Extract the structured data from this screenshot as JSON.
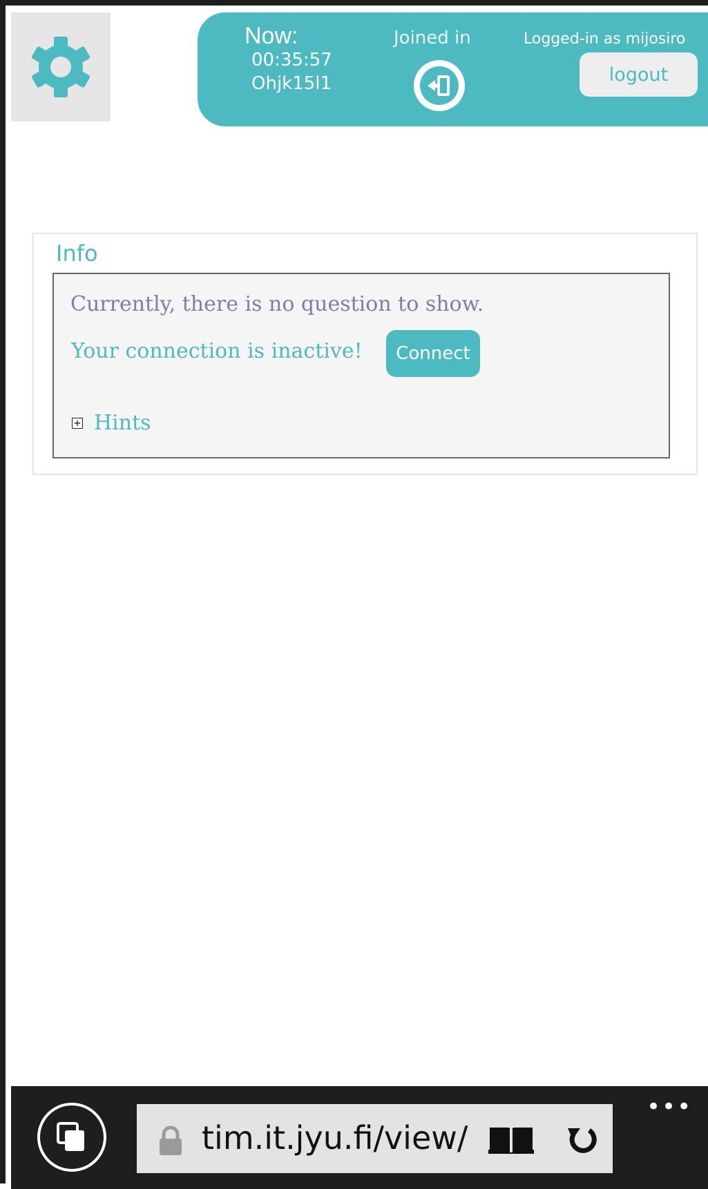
{
  "header": {
    "now_label": "Now:",
    "current_time": "00:35:57",
    "session_code": "Ohjk15l1",
    "joined_label": "Joined in",
    "logged_in_label": "Logged-in as mijosiro",
    "logout_label": "logout"
  },
  "info": {
    "title": "Info",
    "no_question_text": "Currently, there is no question to show.",
    "inactive_text": "Your connection is inactive!",
    "connect_label": "Connect",
    "hints_label": "Hints"
  },
  "browser": {
    "url": "tim.it.jyu.fi/view/",
    "more_label": "•••"
  },
  "colors": {
    "accent": "#4dbac2",
    "muted_text": "#7b7fa8",
    "toolbar_bg": "#1e1e1e",
    "address_bg": "#e3e3e3"
  },
  "icons": {
    "settings": "gear-icon",
    "joined": "enter-icon",
    "tabs": "tabs-icon",
    "lock": "lock-icon",
    "reader": "reading-view-icon",
    "refresh": "refresh-icon",
    "expand": "plus-box-icon"
  }
}
